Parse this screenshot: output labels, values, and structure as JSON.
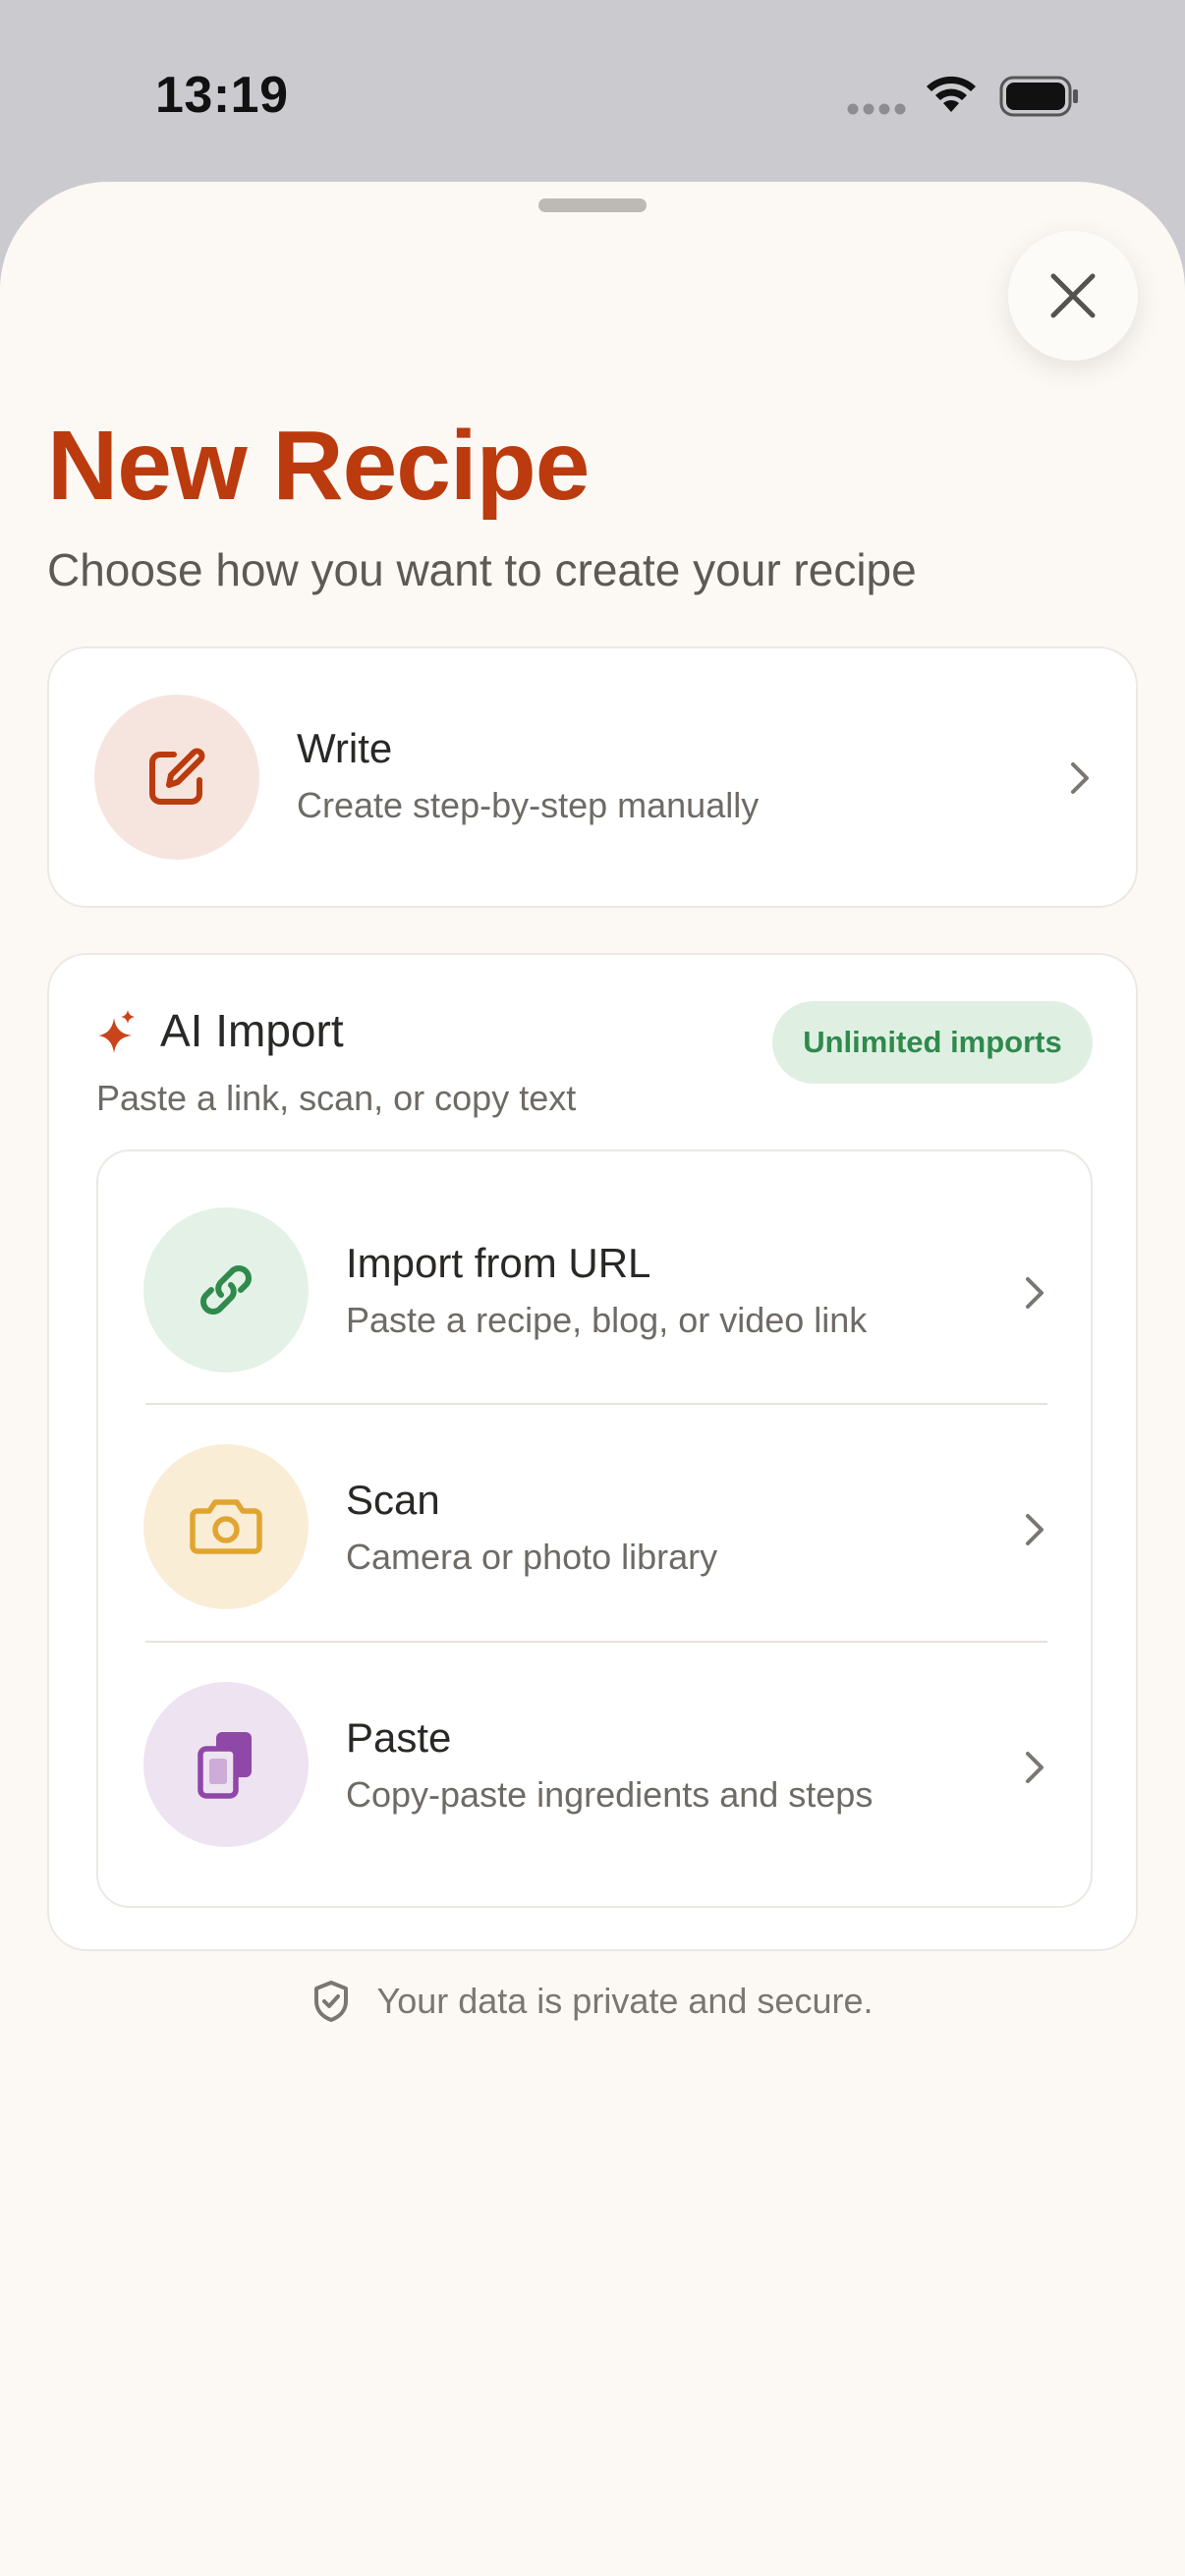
{
  "status": {
    "time": "13:19",
    "icons": [
      "signal-dots-icon",
      "wifi-icon",
      "battery-icon"
    ]
  },
  "sheet": {
    "close_icon": "close-icon",
    "title": "New Recipe",
    "subtitle": "Choose how you want to create your recipe"
  },
  "write": {
    "icon": "edit-icon",
    "title": "Write",
    "subtitle": "Create step-by-step manually"
  },
  "ai_import": {
    "icon": "sparkles-icon",
    "title": "AI Import",
    "subtitle": "Paste a link, scan, or copy text",
    "badge": "Unlimited imports",
    "options": [
      {
        "icon": "link-icon",
        "title": "Import from URL",
        "subtitle": "Paste a recipe, blog, or video link"
      },
      {
        "icon": "camera-icon",
        "title": "Scan",
        "subtitle": "Camera or photo library"
      },
      {
        "icon": "clipboard-icon",
        "title": "Paste",
        "subtitle": "Copy-paste ingredients and steps"
      }
    ]
  },
  "footer": {
    "icon": "shield-check-icon",
    "text": "Your data is private and secure."
  },
  "colors": {
    "accent": "#bb3a0e",
    "sheet_bg": "#fcf9f5",
    "badge_text": "#2f8a4c",
    "badge_bg": "#dff0e3",
    "write_icon_bg": "#f6e5de",
    "url_icon_bg": "#e3f1e7",
    "scan_icon_bg": "#f9edd6",
    "paste_icon_bg": "#eee3f1"
  }
}
